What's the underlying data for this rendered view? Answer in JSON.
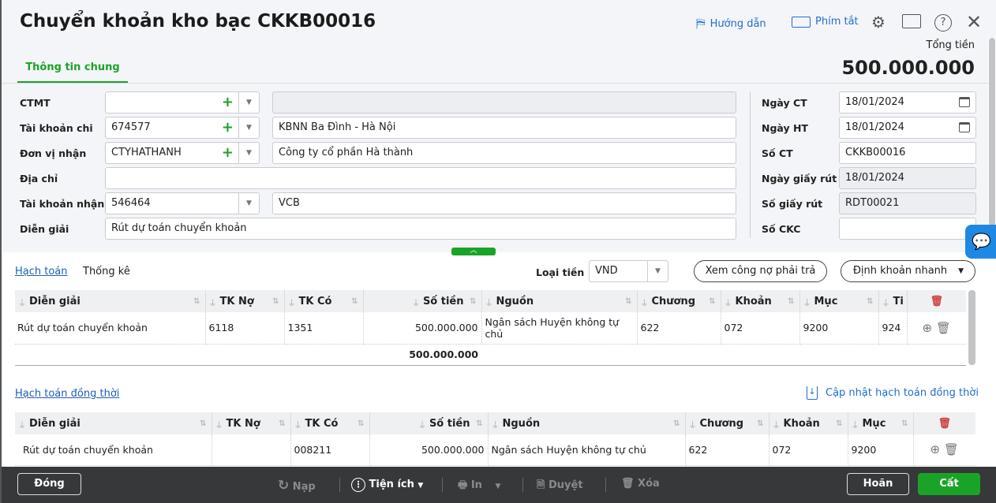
{
  "title": "Chuyển khoản kho bạc CKKB00016",
  "header": {
    "guide": "Hướng dẫn",
    "shortcuts": "Phím tắt",
    "total_label": "Tổng tiền",
    "total_value": "500.000.000"
  },
  "tabs": [
    "Thông tin chung"
  ],
  "form": {
    "ctmt": {
      "label": "CTMT",
      "code": "",
      "name": ""
    },
    "tk_chi": {
      "label": "Tài khoản chi",
      "code": "674577",
      "name": "KBNN Ba Đình - Hà Nội"
    },
    "don_vi": {
      "label": "Đơn vị nhận",
      "code": "CTYHATHANH",
      "name": "Công ty cổ phần Hà thành"
    },
    "dia_chi": {
      "label": "Địa chỉ",
      "value": ""
    },
    "tk_nhan": {
      "label": "Tài khoản nhận",
      "code": "546464",
      "name": "VCB"
    },
    "dien_giai": {
      "label": "Diễn giải",
      "value": "Rút dự toán chuyển khoản"
    },
    "ngay_ct": {
      "label": "Ngày CT",
      "value": "18/01/2024"
    },
    "ngay_ht": {
      "label": "Ngày HT",
      "value": "18/01/2024"
    },
    "so_ct": {
      "label": "Số CT",
      "value": "CKKB00016"
    },
    "ngay_giay_rut": {
      "label": "Ngày giấy rút",
      "value": "18/01/2024"
    },
    "so_giay_rut": {
      "label": "Số giấy rút",
      "value": "RDT00021"
    },
    "so_ckc": {
      "label": "Số CKC",
      "value": ""
    }
  },
  "detail": {
    "tab_hach_toan": "Hạch toán",
    "tab_thong_ke": "Thống kê",
    "currency_label": "Loại tiền",
    "currency": "VND",
    "btn_debt": "Xem công nợ phải trả",
    "btn_quick": "Định khoản nhanh"
  },
  "table1": {
    "columns": [
      "Diễn giải",
      "TK Nợ",
      "TK Có",
      "Số tiền",
      "Nguồn",
      "Chương",
      "Khoản",
      "Mục",
      "Ti"
    ],
    "rows": [
      [
        "Rút dự toán chuyển khoản",
        "6118",
        "1351",
        "500.000.000",
        "Ngân sách Huyện không tự chủ",
        "622",
        "072",
        "9200",
        "924"
      ]
    ],
    "total": "500.000.000"
  },
  "section2": {
    "title": "Hạch toán đồng thời",
    "update": "Cập nhật hạch toán đồng thời"
  },
  "table2": {
    "columns": [
      "Diễn giải",
      "TK Nợ",
      "TK Có",
      "Số tiền",
      "Nguồn",
      "Chương",
      "Khoản",
      "Mục"
    ],
    "rows": [
      [
        "Rút dự toán chuyển khoản",
        "",
        "008211",
        "500.000.000",
        "Ngân sách Huyện không tự chủ",
        "622",
        "072",
        "9200"
      ]
    ]
  },
  "footer": {
    "close": "Đóng",
    "reload": "Nạp",
    "utility": "Tiện ích",
    "print": "In",
    "approve": "Duyệt",
    "delete": "Xóa",
    "postpone": "Hoãn",
    "save": "Cất"
  },
  "colors": {
    "accent": "#1aa427",
    "link": "#1e6fd0",
    "footer": "#37383a"
  }
}
